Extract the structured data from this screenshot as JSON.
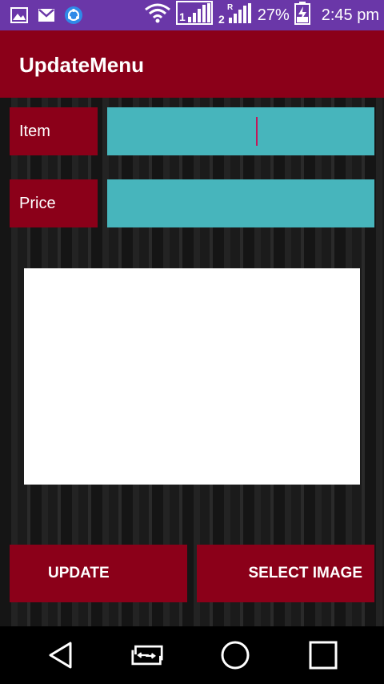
{
  "status_bar": {
    "battery": "27%",
    "time": "2:45 pm",
    "left_icons": [
      "gallery-icon",
      "gmail-icon",
      "shareit-icon"
    ],
    "right_icons": [
      "wifi-icon",
      "signal-sim1-icon",
      "signal-sim2-icon",
      "battery-icon"
    ]
  },
  "app_bar": {
    "title": "UpdateMenu",
    "color": "#8b0019"
  },
  "form": {
    "item_label": "Item",
    "item_value": "",
    "price_label": "Price",
    "price_value": "",
    "field_color": "#47b5bc"
  },
  "buttons": {
    "update": "UPDATE",
    "select_image": "SELECT IMAGE"
  },
  "nav_bar": {
    "icons": [
      "back-icon",
      "switch-sim-icon",
      "home-icon",
      "recents-icon"
    ]
  }
}
